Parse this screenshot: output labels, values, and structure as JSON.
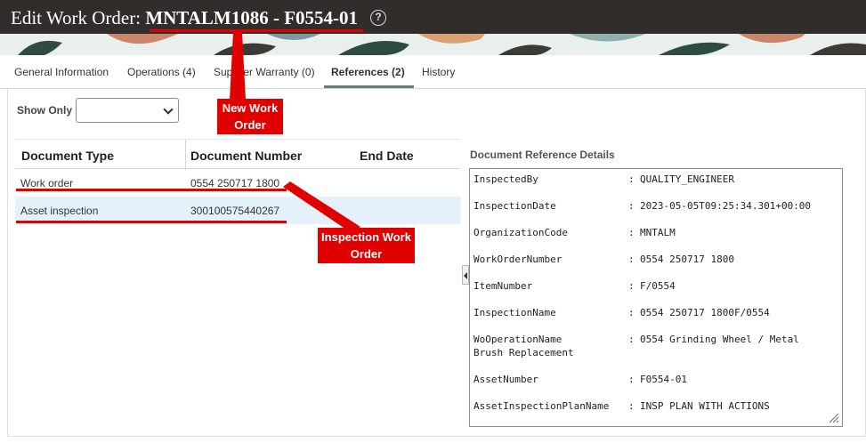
{
  "header": {
    "title_prefix": "Edit Work Order: ",
    "work_order": "MNTALM1086 - F0554-01",
    "help_glyph": "?"
  },
  "tabs": [
    {
      "label": "General Information",
      "active": false
    },
    {
      "label": "Operations (4)",
      "active": false
    },
    {
      "label": "Supplier Warranty (0)",
      "active": false
    },
    {
      "label": "References (2)",
      "active": true
    },
    {
      "label": "History",
      "active": false
    }
  ],
  "filter": {
    "label": "Show Only",
    "value": ""
  },
  "table": {
    "headers": [
      "Document Type",
      "Document Number",
      "End Date"
    ],
    "rows": [
      {
        "type": "Work order",
        "number": "0554 250717 1800",
        "end_date": "",
        "selected": false
      },
      {
        "type": "Asset inspection",
        "number": "300100575440267",
        "end_date": "",
        "selected": true
      }
    ]
  },
  "details": {
    "title": "Document Reference Details",
    "separator": ":",
    "entries": [
      {
        "key": "InspectedBy",
        "value": "QUALITY_ENGINEER"
      },
      {
        "key": "InspectionDate",
        "value": "2023-05-05T09:25:34.301+00:00"
      },
      {
        "key": "OrganizationCode",
        "value": "MNTALM"
      },
      {
        "key": "WorkOrderNumber",
        "value": "0554 250717 1800"
      },
      {
        "key": "ItemNumber",
        "value": "F/0554"
      },
      {
        "key": "InspectionName",
        "value": "0554 250717 1800F/0554"
      },
      {
        "key": "WoOperationName",
        "key_line2": "Brush Replacement",
        "value": "0554 Grinding Wheel / Metal"
      },
      {
        "key": "AssetNumber",
        "value": "F0554-01"
      },
      {
        "key": "AssetInspectionPlanName",
        "value": "INSP PLAN WITH ACTIONS"
      }
    ]
  },
  "annotations": {
    "new_work_order": [
      "New Work",
      "Order"
    ],
    "inspection_work_order": [
      "Inspection Work",
      "Order"
    ],
    "color": "#e00000"
  },
  "colors": {
    "header_bg": "#312d2a",
    "tab_accent": "#5e8272",
    "selected_row": "#e4f0fa"
  }
}
